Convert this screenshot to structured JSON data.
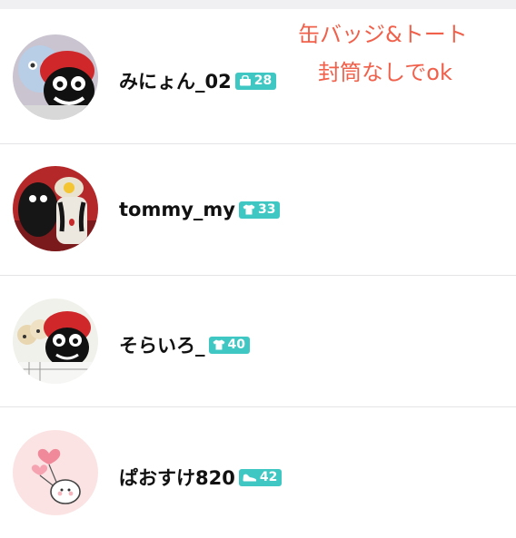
{
  "note": {
    "line1": "缶バッジ&トート",
    "line2": "封筒なしでok"
  },
  "users": [
    {
      "name": "みにょん_02",
      "count": "28",
      "badge_icon": "bag-icon"
    },
    {
      "name": "tommy_my",
      "count": "33",
      "badge_icon": "tshirt-icon"
    },
    {
      "name": "そらいろ_",
      "count": "40",
      "badge_icon": "tshirt-icon"
    },
    {
      "name": "ぱおすけ820",
      "count": "42",
      "badge_icon": "shoe-icon"
    }
  ],
  "colors": {
    "badge": "#3ec7c3",
    "note_text": "#f0604a",
    "divider": "#e4e4e6"
  }
}
